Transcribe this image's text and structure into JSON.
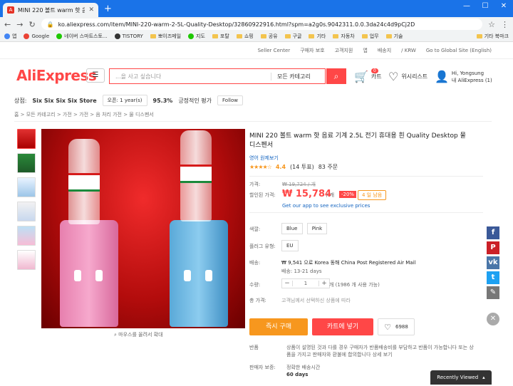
{
  "browser": {
    "tab_title": "MINI 220 볼트 warm 핫 음료 ...",
    "url": "ko.aliexpress.com/item/MINI-220-warm-2-5L-Quality-Desktop/32860922916.html?spm=a2g0s.9042311.0.0.3da24c4d9pCj2D"
  },
  "bookmarks": [
    "앱",
    "Google",
    "네이버 스마트스토...",
    "TISTORY",
    "뽀이즈메일",
    "지도",
    "포탈",
    "쇼핑",
    "공유",
    "구글",
    "기타",
    "자동차",
    "업무",
    "기술",
    "기타 북마크"
  ],
  "topstrip": [
    "Seller Center",
    "구매자 보호",
    "고객지원",
    "앱",
    "배송지",
    "/ KRW",
    "Go to Global Site (English)"
  ],
  "header": {
    "logo_a": "AliExpress",
    "search_placeholder": "...을 사고 싶습니다",
    "search_category": "모든 카테고리",
    "cart_label": "카트",
    "cart_count": "0",
    "wish_label": "위시리스트",
    "user_line1": "Hi, Yongsung",
    "user_line2": "내 AliExpress (1)"
  },
  "store": {
    "label": "상점:",
    "name": "Six Six Six Six Store",
    "open": "오픈: 1 year(s)",
    "rating": "95.3%",
    "rating_label": "긍정적인 평가",
    "follow": "Follow"
  },
  "breadcrumb": "홈 > 모든 카테고리 > 가전 > 가전 > 음 처리 가전 > 물 디스펜서",
  "image": {
    "zoom_hint": "마우스를 올려서 확대"
  },
  "product": {
    "title": "MINI 220 볼트 warm 핫 음료 기계 2.5L 전기 휴대용 흰 Quality Desktop 물 디스펜서",
    "translate": "영어 원제보기",
    "rating": "4.4",
    "reviews": "(14 투표)",
    "orders": "83 주문",
    "price_label": "가격:",
    "orig_price": "₩ 19,724 / 개",
    "sale_label": "할인된 가격:",
    "sale_price": "₩ 15,784",
    "per": "/ 개",
    "discount": "-20%",
    "days_left": "4 일 남음",
    "app_text": "Get our app to see exclusive prices",
    "color_label": "색깔:",
    "colors": [
      "Blue",
      "Pink"
    ],
    "plug_label": "플러그 유형:",
    "plug": "EU",
    "ship_label": "배송:",
    "ship_text": "₩ 9,541 으로 Korea 동해 China Post Registered Air Mail",
    "ship_days": "배송: 13-21 days",
    "qty_label": "수량:",
    "qty_value": "1",
    "qty_note": "개 (1986 개 사용 가능)",
    "total_label": "총 가격:",
    "total_note": "고객님께서 선택하신 상품에 따라",
    "buy_now": "즉시 구매",
    "add_cart": "카트에 넣기",
    "wish_count": "6988",
    "return_label": "반품",
    "return_text": "상품이 설명된 것과 다를 경우 구매자가 반품배송비를 부담하고 반품이 가능합니다 또는 상품을 가지고 판매자와 환불에 합의합니다 상세 보기",
    "protect_label": "판매자 보증:",
    "protect_text": "정확한 배송시간",
    "protect_days": "60 days"
  },
  "recently_viewed": "Recently Viewed",
  "colors": {
    "accent": "#ff4747",
    "orange": "#f7971e",
    "chrome_blue": "#1a73e8"
  }
}
